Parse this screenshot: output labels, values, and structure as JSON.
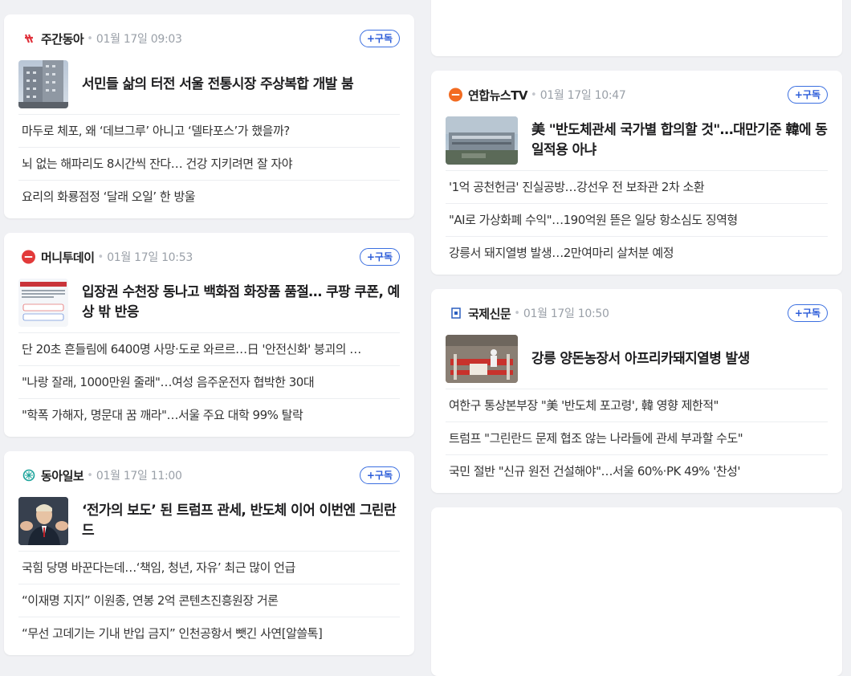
{
  "cards": [
    {
      "press": "주간동아",
      "time": "01월 17일 09:03",
      "subscribe": "+구독",
      "headline": "서민들 삶의 터전 서울 전통시장 주상복합 개발 붐",
      "items": [
        "마두로 체포, 왜 ‘데브그루’ 아니고 ‘델타포스’가 했을까?",
        "뇌 없는 해파리도 8시간씩 잔다… 건강 지키려면 잘 자야",
        "요리의 화룡점정 ‘달래 오일’ 한 방울"
      ]
    },
    {
      "press": "머니투데이",
      "time": "01월 17일 10:53",
      "subscribe": "+구독",
      "headline": "입장권 수천장 동나고 백화점 화장품 품절… 쿠팡 쿠폰, 예상 밖 반응",
      "items": [
        "단 20초 흔들림에 6400명 사망·도로 와르르…日 '안전신화' 붕괴의 …",
        "\"나랑 잘래, 1000만원 줄래\"…여성 음주운전자 협박한 30대",
        "\"학폭 가해자, 명문대 꿈 깨라\"…서울 주요 대학 99% 탈락"
      ]
    },
    {
      "press": "동아일보",
      "time": "01월 17일 11:00",
      "subscribe": "+구독",
      "headline": "‘전가의 보도’ 된 트럼프 관세, 반도체 이어 이번엔 그린란드",
      "items": [
        "국힘 당명 바꾼다는데…‘책임, 청년, 자유’ 최근 많이 언급",
        "“이재명 지지” 이원종, 연봉 2억 콘텐츠진흥원장 거론",
        "“무선 고데기는 기내 반입 금지” 인천공항서 뺏긴 사연[알쓸톡]"
      ]
    },
    {
      "press": "연합뉴스TV",
      "time": "01월 17일 10:47",
      "subscribe": "+구독",
      "headline": "美 \"반도체관세 국가별 합의할 것\"…대만기준 韓에 동일적용 아냐",
      "items": [
        "'1억 공천헌금' 진실공방…강선우 전 보좌관 2차 소환",
        "\"AI로 가상화폐 수익\"…190억원 뜯은 일당 항소심도 징역형",
        "강릉서 돼지열병 발생…2만여마리 살처분 예정"
      ]
    },
    {
      "press": "국제신문",
      "time": "01월 17일 10:50",
      "subscribe": "+구독",
      "headline": "강릉 양돈농장서 아프리카돼지열병 발생",
      "items": [
        "여한구 통상본부장 \"美 '반도체 포고령', 韓 영향 제한적\"",
        "트럼프 \"그린란드 문제 협조 않는 나라들에 관세 부과할 수도\"",
        "국민 절반 \"신규 원전 건설해야\"…서울 60%·PK 49% '찬성'"
      ]
    }
  ]
}
